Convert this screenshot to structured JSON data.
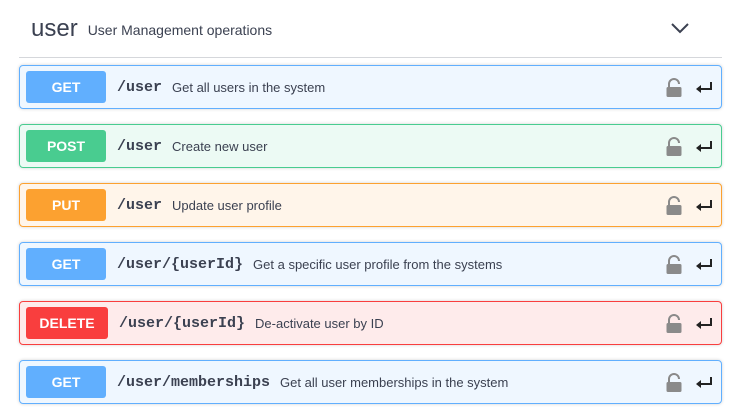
{
  "tag": {
    "name": "user",
    "description": "User Management operations",
    "collapse_icon": "chevron-down-icon"
  },
  "operations": [
    {
      "method": "GET",
      "path": "/user",
      "summary": "Get all users in the system"
    },
    {
      "method": "POST",
      "path": "/user",
      "summary": "Create new user"
    },
    {
      "method": "PUT",
      "path": "/user",
      "summary": "Update user profile"
    },
    {
      "method": "GET",
      "path": "/user/{userId}",
      "summary": "Get a specific user profile from the systems"
    },
    {
      "method": "DELETE",
      "path": "/user/{userId}",
      "summary": "De-activate user by ID"
    },
    {
      "method": "GET",
      "path": "/user/memberships",
      "summary": "Get all user memberships in the system"
    }
  ],
  "icons": {
    "lock": "lock-icon",
    "return": "return-arrow-icon"
  },
  "colors": {
    "get": "#61affe",
    "post": "#49cc90",
    "put": "#fca130",
    "delete": "#f93e3e"
  }
}
